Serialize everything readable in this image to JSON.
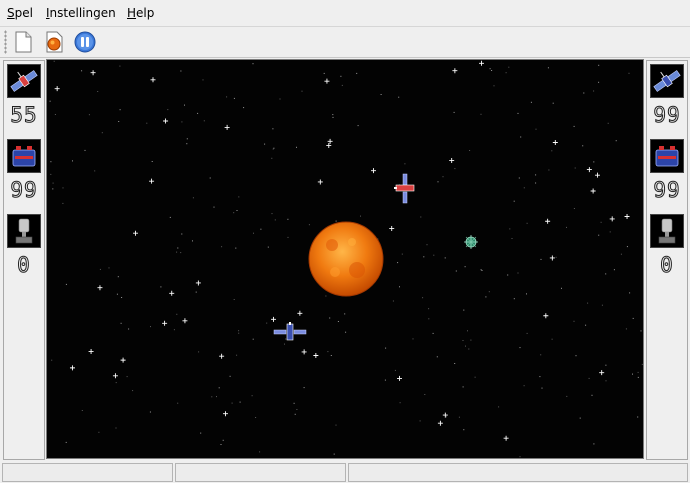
{
  "menu": {
    "items": [
      {
        "label": "Spel",
        "mnemonic": "S",
        "rest": "pel"
      },
      {
        "label": "Instellingen",
        "mnemonic": "I",
        "rest": "nstellingen"
      },
      {
        "label": "Help",
        "mnemonic": "H",
        "rest": "elp"
      }
    ]
  },
  "toolbar": {
    "buttons": [
      {
        "icon": "new-game-icon"
      },
      {
        "icon": "game-sun-icon"
      },
      {
        "icon": "pause-icon"
      }
    ]
  },
  "players": {
    "left": {
      "energy": "55",
      "shields": "99",
      "wins": "0",
      "ship_icon": "satellite-icon",
      "energy_icon": "battery-icon",
      "wins_icon": "trophy-icon"
    },
    "right": {
      "energy": "99",
      "shields": "99",
      "wins": "0",
      "ship_icon": "satellite-icon",
      "energy_icon": "battery-icon",
      "wins_icon": "trophy-icon"
    }
  },
  "arena": {
    "background": "#030303",
    "sun_color": "#f07a10",
    "objects": [
      "sun",
      "player-ship-1",
      "player-ship-2",
      "mine"
    ]
  },
  "statusbar": {
    "segments": [
      "",
      "",
      ""
    ]
  }
}
